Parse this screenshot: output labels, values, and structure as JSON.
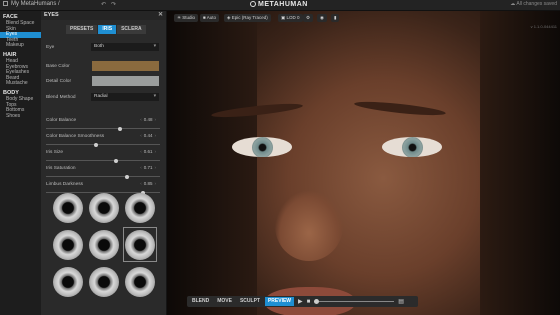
{
  "topbar": {
    "breadcrumb": "My MetaHumans /",
    "app_name": "METAHUMAN",
    "save_status": "All changes saved",
    "version": "v 1.1.0-044411"
  },
  "nav": {
    "sections": [
      {
        "title": "FACE",
        "items": [
          {
            "label": "Blend Space",
            "active": false
          },
          {
            "label": "Skin",
            "active": false
          },
          {
            "label": "Eyes",
            "active": true
          },
          {
            "label": "Teeth",
            "active": false
          },
          {
            "label": "Makeup",
            "active": false
          }
        ]
      },
      {
        "title": "HAIR",
        "items": [
          {
            "label": "Head",
            "active": false
          },
          {
            "label": "Eyebrows",
            "active": false
          },
          {
            "label": "Eyelashes",
            "active": false
          },
          {
            "label": "Beard",
            "active": false
          },
          {
            "label": "Mustache",
            "active": false
          }
        ]
      },
      {
        "title": "BODY",
        "items": [
          {
            "label": "Body Shape",
            "active": false
          },
          {
            "label": "Tops",
            "active": false
          },
          {
            "label": "Bottoms",
            "active": false
          },
          {
            "label": "Shoes",
            "active": false
          }
        ]
      }
    ]
  },
  "panel": {
    "title": "EYES",
    "tabs": [
      "PRESETS",
      "IRIS",
      "SCLERA"
    ],
    "active_tab": "IRIS",
    "eye": {
      "label": "Eye",
      "value": "Both"
    },
    "base_color": {
      "label": "Base Color",
      "color": "#8a6a3e"
    },
    "detail_color": {
      "label": "Detail Color",
      "color": "#9a9d9c"
    },
    "blend_method": {
      "label": "Blend Method",
      "value": "Radial"
    },
    "sliders": [
      {
        "label": "Color Balance",
        "value": "0.48",
        "fraction": 0.65
      },
      {
        "label": "Color Balance Smoothness",
        "value": "0.44",
        "fraction": 0.44
      },
      {
        "label": "Iris Size",
        "value": "0.61",
        "fraction": 0.62
      },
      {
        "label": "Iris Saturation",
        "value": "0.71",
        "fraction": 0.72
      },
      {
        "label": "Limbus Darkness",
        "value": "0.85",
        "fraction": 0.86
      }
    ],
    "iris_presets_count": 9,
    "selected_preset_index": 5
  },
  "viewport": {
    "toolbar": [
      "Studio",
      "Auto",
      "Epic (Ray Traced)",
      "LOD 0"
    ],
    "modes": [
      "BLEND",
      "MOVE",
      "SCULPT",
      "PREVIEW"
    ],
    "active_mode": "PREVIEW"
  }
}
